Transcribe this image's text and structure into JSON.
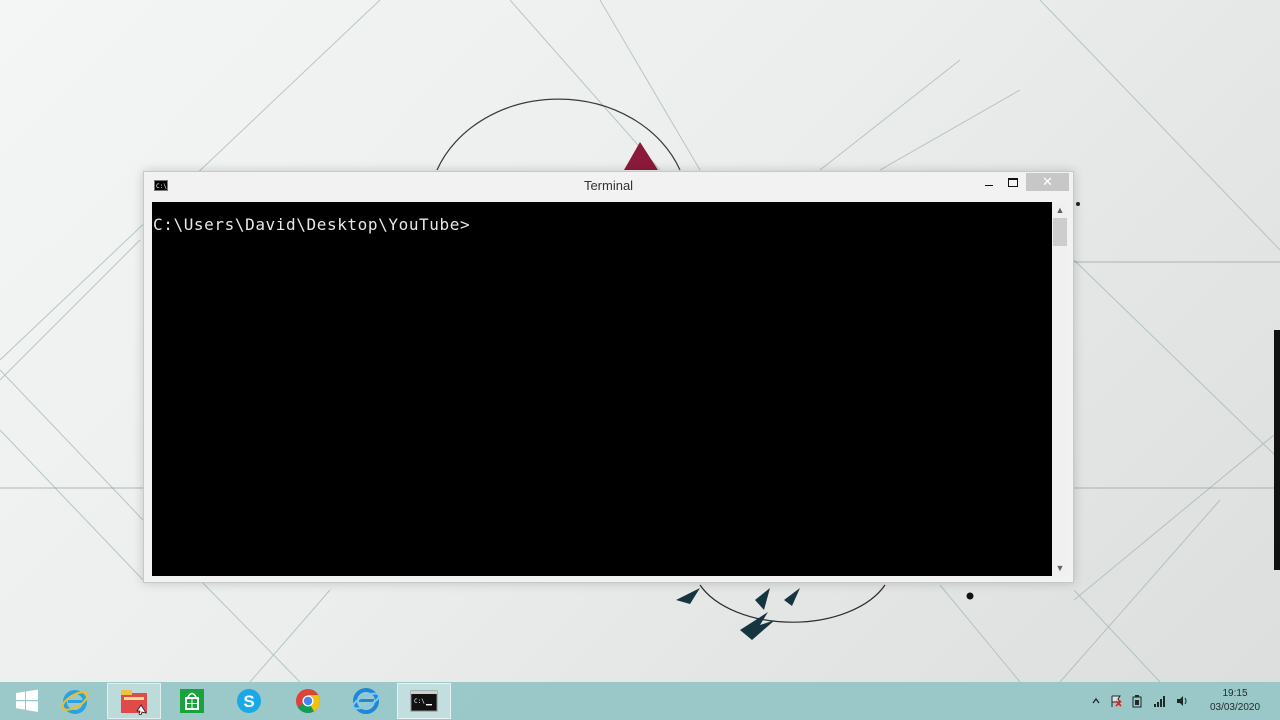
{
  "window": {
    "title": "Terminal",
    "app_icon_text": "C:\\",
    "close_glyph": "✕"
  },
  "console": {
    "prompt": "C:\\Users\\David\\Desktop\\YouTube>"
  },
  "scrollbar": {
    "up_glyph": "▲",
    "down_glyph": "▼"
  },
  "taskbar": {
    "pinned": [
      "start-icon",
      "internet-explorer-icon",
      "file-explorer-icon",
      "store-icon",
      "skype-icon",
      "chrome-icon",
      "edge-icon",
      "command-prompt-icon"
    ]
  },
  "tray": {
    "icons": [
      "show-hidden-icons-chevron",
      "action-center-flag-icon",
      "power-icon",
      "network-signal-icon",
      "volume-icon"
    ],
    "time": "19:15",
    "date": "03/03/2020"
  },
  "colors": {
    "taskbar": "#94c4c4",
    "accent_triangle": "#8b1a3a"
  }
}
